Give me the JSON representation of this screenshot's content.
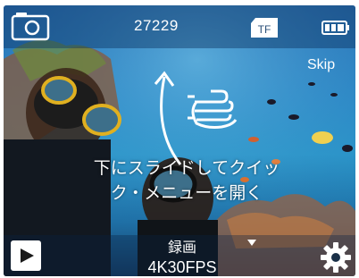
{
  "topbar": {
    "mode_icon": "photo-mode-icon",
    "counter": "27229",
    "storage_label": "TF",
    "battery_icon": "battery-full-icon"
  },
  "overlay": {
    "skip_label": "Skip",
    "hint_line1": "下にスライドしてクイッ",
    "hint_line2": "ク・メニューを開く",
    "gesture_icon": "swipe-hand-icon",
    "arrow_icon": "curved-arrow-icon"
  },
  "bottombar": {
    "playback_icon": "play-icon",
    "mode_label": "録画",
    "resolution_label": "4K30FPS",
    "dropdown_icon": "caret-down-icon",
    "settings_icon": "gear-icon"
  }
}
